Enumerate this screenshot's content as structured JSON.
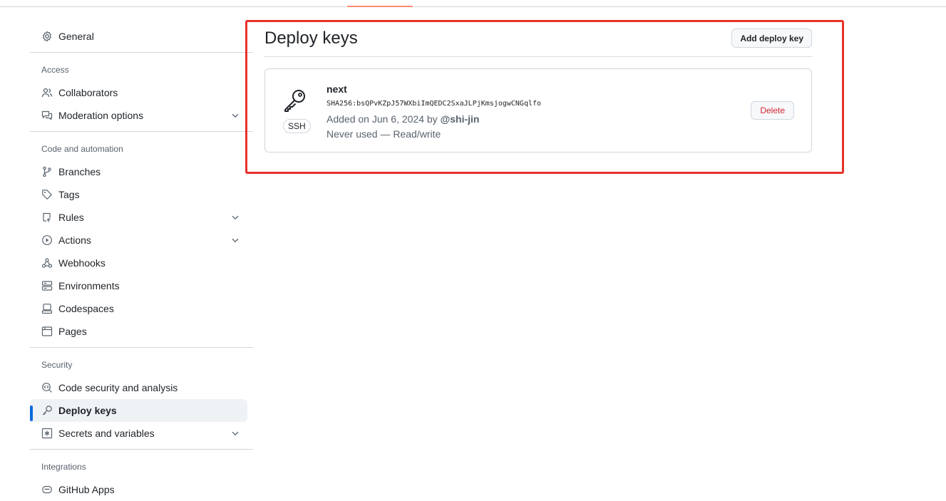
{
  "sidebar": {
    "general": "General",
    "access_title": "Access",
    "collaborators": "Collaborators",
    "moderation": "Moderation options",
    "code_title": "Code and automation",
    "branches": "Branches",
    "tags": "Tags",
    "rules": "Rules",
    "actions": "Actions",
    "webhooks": "Webhooks",
    "environments": "Environments",
    "codespaces": "Codespaces",
    "pages": "Pages",
    "security_title": "Security",
    "code_security": "Code security and analysis",
    "deploy_keys": "Deploy keys",
    "secrets": "Secrets and variables",
    "integrations_title": "Integrations",
    "github_apps": "GitHub Apps"
  },
  "main": {
    "title": "Deploy keys",
    "add_button": "Add deploy key",
    "key": {
      "badge": "SSH",
      "name": "next",
      "fingerprint": "SHA256:bsQPvKZpJ57WXbiImQEDC2SxaJLPjKmsjogwCNGqlfo",
      "added_prefix": "Added on Jun 6, 2024 by",
      "added_user": "@shi-jin",
      "usage": "Never used — Read/write",
      "delete_button": "Delete"
    }
  },
  "colors": {
    "accent": "#0969da",
    "danger": "#d1242f",
    "highlight": "#e8302a"
  }
}
